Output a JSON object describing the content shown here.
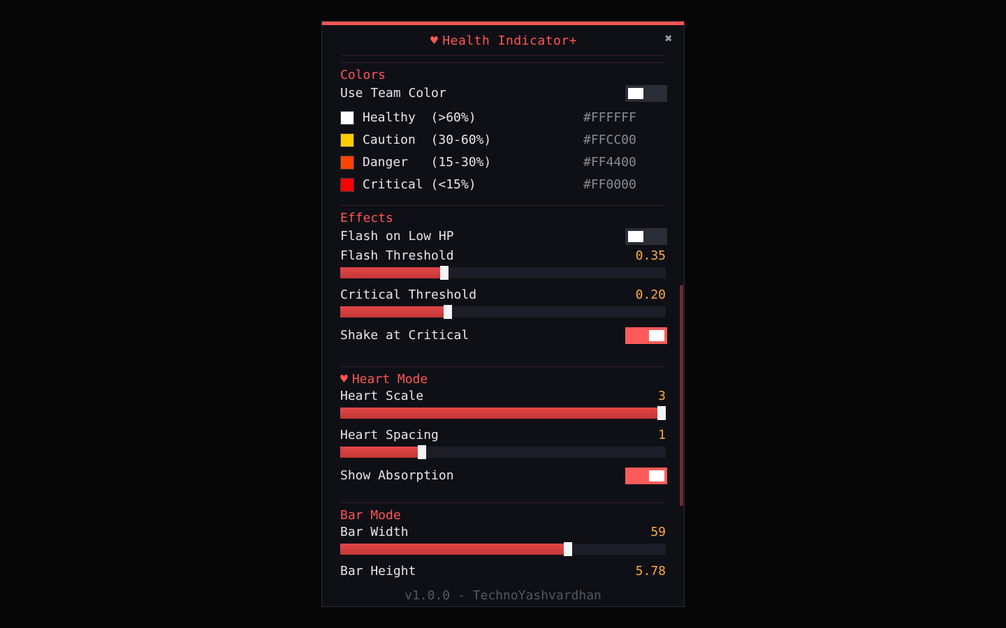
{
  "window": {
    "title": "Health Indicator+",
    "close_label": "✖",
    "accent": "#FF5555"
  },
  "colors_section": {
    "title": "Colors",
    "use_team_color": {
      "label": "Use Team Color",
      "enabled": false
    },
    "items": [
      {
        "name": "Healthy  (>60%)",
        "hex": "#FFFFFF",
        "swatch": "#FFFFFF"
      },
      {
        "name": "Caution  (30-60%)",
        "hex": "#FFCC00",
        "swatch": "#FFCC00"
      },
      {
        "name": "Danger   (15-30%)",
        "hex": "#FF4400",
        "swatch": "#FF4400"
      },
      {
        "name": "Critical (<15%)",
        "hex": "#FF0000",
        "swatch": "#FF0000"
      }
    ]
  },
  "effects_section": {
    "title": "Effects",
    "flash_on_low_hp": {
      "label": "Flash on Low HP",
      "enabled": false
    },
    "flash_threshold": {
      "label": "Flash Threshold",
      "value": "0.35",
      "fraction": 0.32
    },
    "critical_threshold": {
      "label": "Critical Threshold",
      "value": "0.20",
      "fraction": 0.33
    },
    "shake_at_critical": {
      "label": "Shake at Critical",
      "enabled": true
    }
  },
  "heart_section": {
    "title": "Heart Mode",
    "icon": "heart-icon",
    "heart_scale": {
      "label": "Heart Scale",
      "value": "3",
      "fraction": 1.0
    },
    "heart_spacing": {
      "label": "Heart Spacing",
      "value": "1",
      "fraction": 0.25
    },
    "show_absorption": {
      "label": "Show Absorption",
      "enabled": true
    }
  },
  "bar_section": {
    "title": "Bar Mode",
    "bar_width": {
      "label": "Bar Width",
      "value": "59",
      "fraction": 0.7
    },
    "bar_height": {
      "label": "Bar Height",
      "value": "5.78"
    }
  },
  "footer": {
    "text": "v1.0.0 - TechnoYashvardhan"
  }
}
